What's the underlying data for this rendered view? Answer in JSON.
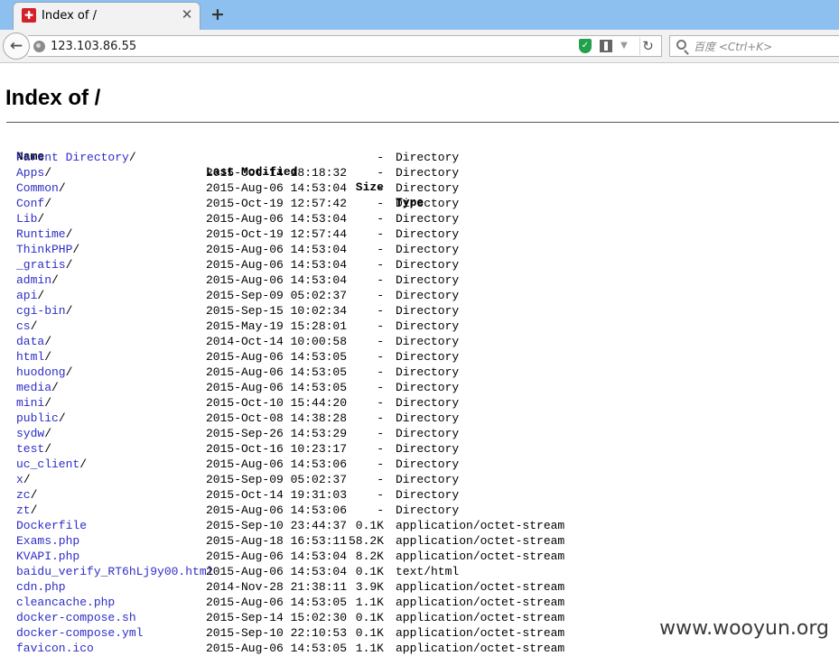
{
  "tab": {
    "title": "Index of /",
    "favicon": "tab-favicon-icon"
  },
  "urlbar": {
    "url": "123.103.86.55"
  },
  "search": {
    "placeholder": "百度 <Ctrl+K>"
  },
  "page": {
    "heading": "Index of /",
    "columns": {
      "name": "Name",
      "modified": "Last Modified",
      "size": "Size",
      "type": "Type"
    },
    "rows": [
      {
        "name": "Parent Directory",
        "slash": "/",
        "modified": "",
        "size": "-",
        "type": "Directory"
      },
      {
        "name": "Apps",
        "slash": "/",
        "modified": "2015-Oct-14 18:18:32",
        "size": "-",
        "type": "Directory"
      },
      {
        "name": "Common",
        "slash": "/",
        "modified": "2015-Aug-06 14:53:04",
        "size": "-",
        "type": "Directory"
      },
      {
        "name": "Conf",
        "slash": "/",
        "modified": "2015-Oct-19 12:57:42",
        "size": "-",
        "type": "Directory"
      },
      {
        "name": "Lib",
        "slash": "/",
        "modified": "2015-Aug-06 14:53:04",
        "size": "-",
        "type": "Directory"
      },
      {
        "name": "Runtime",
        "slash": "/",
        "modified": "2015-Oct-19 12:57:44",
        "size": "-",
        "type": "Directory"
      },
      {
        "name": "ThinkPHP",
        "slash": "/",
        "modified": "2015-Aug-06 14:53:04",
        "size": "-",
        "type": "Directory"
      },
      {
        "name": "_gratis",
        "slash": "/",
        "modified": "2015-Aug-06 14:53:04",
        "size": "-",
        "type": "Directory"
      },
      {
        "name": "admin",
        "slash": "/",
        "modified": "2015-Aug-06 14:53:04",
        "size": "-",
        "type": "Directory"
      },
      {
        "name": "api",
        "slash": "/",
        "modified": "2015-Sep-09 05:02:37",
        "size": "-",
        "type": "Directory"
      },
      {
        "name": "cgi-bin",
        "slash": "/",
        "modified": "2015-Sep-15 10:02:34",
        "size": "-",
        "type": "Directory"
      },
      {
        "name": "cs",
        "slash": "/",
        "modified": "2015-May-19 15:28:01",
        "size": "-",
        "type": "Directory"
      },
      {
        "name": "data",
        "slash": "/",
        "modified": "2014-Oct-14 10:00:58",
        "size": "-",
        "type": "Directory"
      },
      {
        "name": "html",
        "slash": "/",
        "modified": "2015-Aug-06 14:53:05",
        "size": "-",
        "type": "Directory"
      },
      {
        "name": "huodong",
        "slash": "/",
        "modified": "2015-Aug-06 14:53:05",
        "size": "-",
        "type": "Directory"
      },
      {
        "name": "media",
        "slash": "/",
        "modified": "2015-Aug-06 14:53:05",
        "size": "-",
        "type": "Directory"
      },
      {
        "name": "mini",
        "slash": "/",
        "modified": "2015-Oct-10 15:44:20",
        "size": "-",
        "type": "Directory"
      },
      {
        "name": "public",
        "slash": "/",
        "modified": "2015-Oct-08 14:38:28",
        "size": "-",
        "type": "Directory"
      },
      {
        "name": "sydw",
        "slash": "/",
        "modified": "2015-Sep-26 14:53:29",
        "size": "-",
        "type": "Directory"
      },
      {
        "name": "test",
        "slash": "/",
        "modified": "2015-Oct-16 10:23:17",
        "size": "-",
        "type": "Directory"
      },
      {
        "name": "uc_client",
        "slash": "/",
        "modified": "2015-Aug-06 14:53:06",
        "size": "-",
        "type": "Directory"
      },
      {
        "name": "x",
        "slash": "/",
        "modified": "2015-Sep-09 05:02:37",
        "size": "-",
        "type": "Directory"
      },
      {
        "name": "zc",
        "slash": "/",
        "modified": "2015-Oct-14 19:31:03",
        "size": "-",
        "type": "Directory"
      },
      {
        "name": "zt",
        "slash": "/",
        "modified": "2015-Aug-06 14:53:06",
        "size": "-",
        "type": "Directory"
      },
      {
        "name": "Dockerfile",
        "slash": "",
        "modified": "2015-Sep-10 23:44:37",
        "size": "0.1K",
        "type": "application/octet-stream"
      },
      {
        "name": "Exams.php",
        "slash": "",
        "modified": "2015-Aug-18 16:53:11",
        "size": "58.2K",
        "type": "application/octet-stream"
      },
      {
        "name": "KVAPI.php",
        "slash": "",
        "modified": "2015-Aug-06 14:53:04",
        "size": "8.2K",
        "type": "application/octet-stream"
      },
      {
        "name": "baidu_verify_RT6hLj9y00.html",
        "slash": "",
        "modified": "2015-Aug-06 14:53:04",
        "size": "0.1K",
        "type": "text/html"
      },
      {
        "name": "cdn.php",
        "slash": "",
        "modified": "2014-Nov-28 21:38:11",
        "size": "3.9K",
        "type": "application/octet-stream"
      },
      {
        "name": "cleancache.php",
        "slash": "",
        "modified": "2015-Aug-06 14:53:05",
        "size": "1.1K",
        "type": "application/octet-stream"
      },
      {
        "name": "docker-compose.sh",
        "slash": "",
        "modified": "2015-Sep-14 15:02:30",
        "size": "0.1K",
        "type": "application/octet-stream"
      },
      {
        "name": "docker-compose.yml",
        "slash": "",
        "modified": "2015-Sep-10 22:10:53",
        "size": "0.1K",
        "type": "application/octet-stream"
      },
      {
        "name": "favicon.ico",
        "slash": "",
        "modified": "2015-Aug-06 14:53:05",
        "size": "1.1K",
        "type": "application/octet-stream"
      }
    ]
  },
  "watermark": "www.wooyun.org",
  "colors": {
    "link": "#2d2dc8",
    "tabbar": "#8dc0ef",
    "shield": "#22a04b"
  }
}
